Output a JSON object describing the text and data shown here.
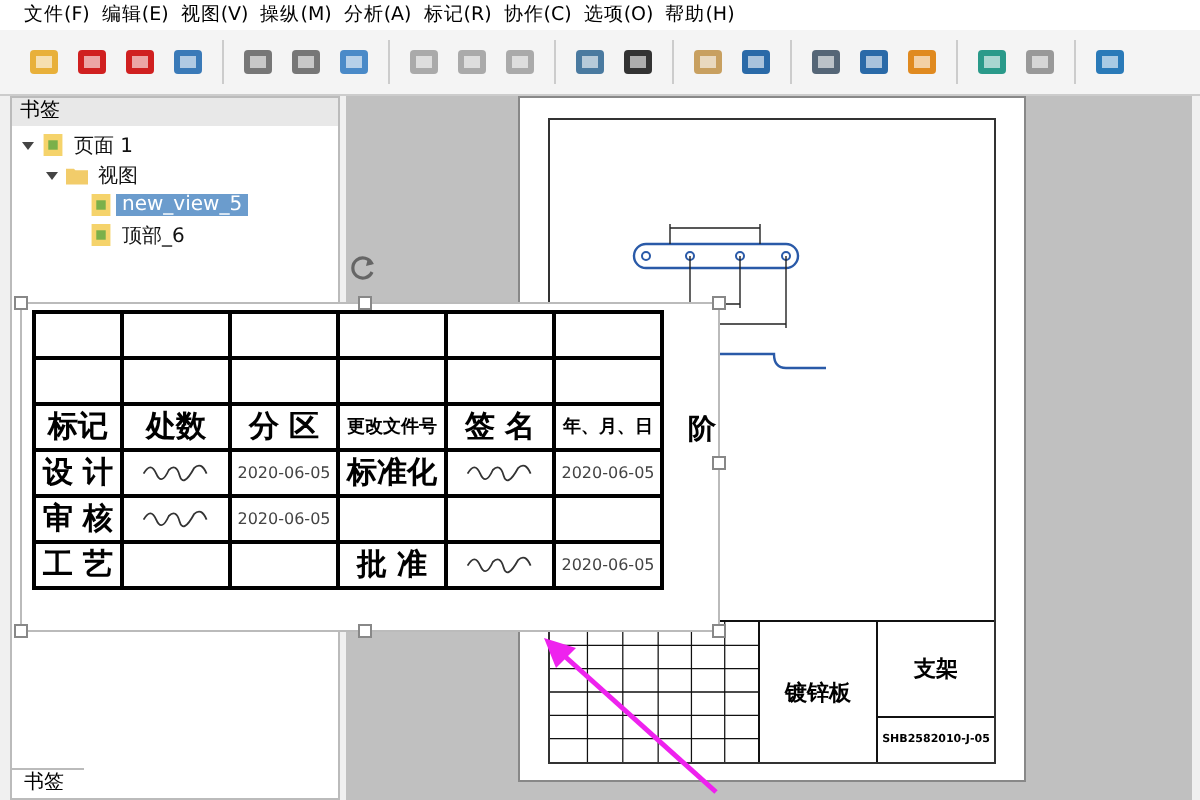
{
  "menu": [
    "文件(F)",
    "编辑(E)",
    "视图(V)",
    "操纵(M)",
    "分析(A)",
    "标记(R)",
    "协作(C)",
    "选项(O)",
    "帮助(H)"
  ],
  "sidebar": {
    "title": "书签",
    "bottom_tab": "书签",
    "tree": [
      {
        "label": "页面 1",
        "kind": "page",
        "expanded": true,
        "selected": false,
        "children": [
          {
            "label": "视图",
            "kind": "folder",
            "expanded": true,
            "selected": false,
            "children": [
              {
                "label": "new_view_5",
                "kind": "page",
                "selected": true
              },
              {
                "label": "顶部_6",
                "kind": "page",
                "selected": false
              }
            ]
          }
        ]
      }
    ]
  },
  "zoom_table": {
    "rows": [
      [
        {
          "kind": "empty"
        },
        {
          "kind": "empty"
        },
        {
          "kind": "empty"
        },
        {
          "kind": "empty"
        },
        {
          "kind": "empty"
        },
        {
          "kind": "empty"
        }
      ],
      [
        {
          "kind": "empty"
        },
        {
          "kind": "empty"
        },
        {
          "kind": "empty"
        },
        {
          "kind": "empty"
        },
        {
          "kind": "empty"
        },
        {
          "kind": "empty"
        }
      ],
      [
        {
          "kind": "label",
          "text": "标记"
        },
        {
          "kind": "label",
          "text": "处数"
        },
        {
          "kind": "label",
          "text": "分 区"
        },
        {
          "kind": "small",
          "text": "更改文件号"
        },
        {
          "kind": "label",
          "text": "签 名"
        },
        {
          "kind": "small",
          "text": "年、月、日"
        }
      ],
      [
        {
          "kind": "label",
          "text": "设 计"
        },
        {
          "kind": "signature"
        },
        {
          "kind": "date",
          "text": "2020-06-05"
        },
        {
          "kind": "label",
          "text": "标准化"
        },
        {
          "kind": "signature"
        },
        {
          "kind": "date",
          "text": "2020-06-05"
        }
      ],
      [
        {
          "kind": "label",
          "text": "审 核"
        },
        {
          "kind": "signature"
        },
        {
          "kind": "date",
          "text": "2020-06-05"
        },
        {
          "kind": "empty"
        },
        {
          "kind": "empty"
        },
        {
          "kind": "empty"
        }
      ],
      [
        {
          "kind": "label",
          "text": "工 艺"
        },
        {
          "kind": "empty"
        },
        {
          "kind": "empty"
        },
        {
          "kind": "label",
          "text": "批 准"
        },
        {
          "kind": "signature"
        },
        {
          "kind": "date",
          "text": "2020-06-05"
        }
      ]
    ],
    "side_column": "阶"
  },
  "title_block": {
    "material": "镀锌板",
    "part_name": "支架",
    "drawing_number": "SHB2582010-J-05"
  }
}
